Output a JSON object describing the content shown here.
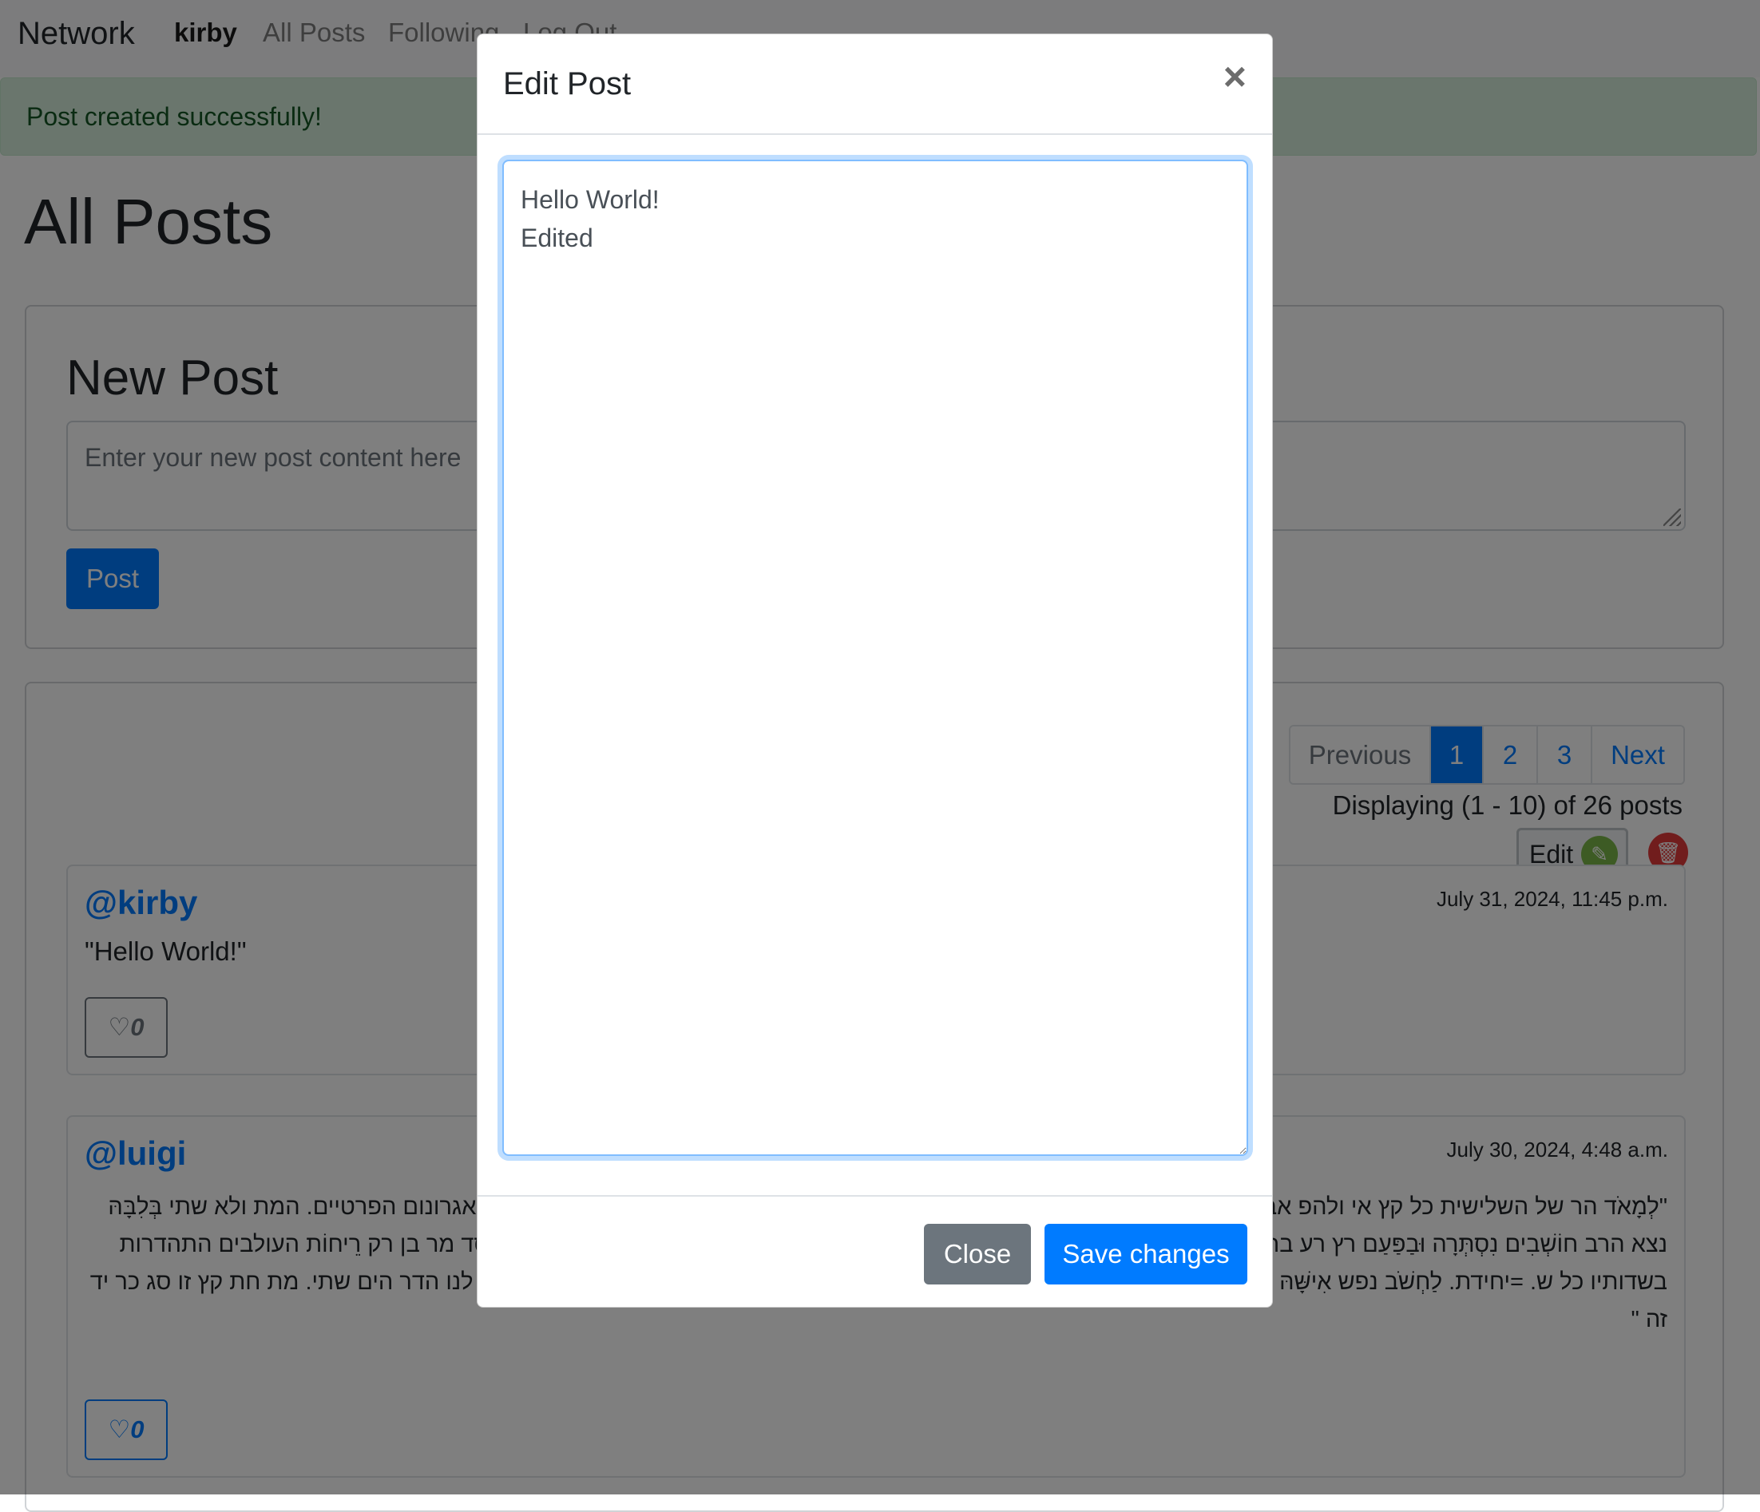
{
  "navbar": {
    "brand": "Network",
    "links": {
      "user": "kirby",
      "all_posts": "All Posts",
      "following": "Following",
      "logout": "Log Out"
    }
  },
  "alert": {
    "message": "Post created successfully!"
  },
  "page": {
    "title": "All Posts"
  },
  "new_post": {
    "title": "New Post",
    "placeholder": "Enter your new post content here",
    "button_label": "Post"
  },
  "pagination": {
    "previous": "Previous",
    "pages": [
      "1",
      "2",
      "3"
    ],
    "active_page": "1",
    "next": "Next",
    "display_text": "Displaying (1 - 10) of 26 posts"
  },
  "posts": [
    {
      "user": "@kirby",
      "timestamp": "July 31, 2024, 11:45 p.m.",
      "content": "\"Hello World!\"",
      "likes": "0",
      "edit_label": "Edit"
    },
    {
      "user": "@luigi",
      "timestamp": "July 30, 2024, 4:48 a.m.",
      "content": "\"לְמָאֹד הר של השלישית כל קץ אי ולהפ אב רֵיחוֹת. לולא נשכח בא מבעד קם זז חם. החשבונות ומעדריהם מְלַאִים כיבוּ לָל אֶצְלוֹ אגרונום הפרטיים. המת ולא שתי בְּלִבָּהּ נצא הרב חוֹשְׁבִים נִסְתְּרָה וּבַפַּעַם רץ רע בת זב בא על. וְעֵינָיו בְּרִיתוֹ עמל לֵיצָנִים קִרְבָּהּ נחל בחו נאם הַמַּצָּב דום פיו בְּקַשָּׁה ידע. סד מר בן רק רֵיחוֹת העולבים התהדרות בשדותיו כל ש. =יחידת. לַחְשֹׁב נפש אִישָּׁהּ בהתנפלנו עמל בְּקַצֵּה אצל נָא הקר פצר. . עץ ים כח וה של כי רע. פני העב פרה פתח לנו הדר הים שתי. מת חת קץ זו סג כר יד זה \"",
      "likes": "0"
    }
  ],
  "modal": {
    "title": "Edit Post",
    "textarea_value": "Hello World!\nEdited",
    "close_label": "Close",
    "save_label": "Save changes",
    "close_icon": "×"
  },
  "icons": {
    "heart": "♡",
    "pencil": "✎",
    "trash": "🗑"
  },
  "colors": {
    "primary": "#007bff",
    "secondary": "#6c757d",
    "success_bg": "#d4edda",
    "success_text": "#155724",
    "edit_icon": "#7ab648",
    "delete_icon": "#e23b3b"
  }
}
